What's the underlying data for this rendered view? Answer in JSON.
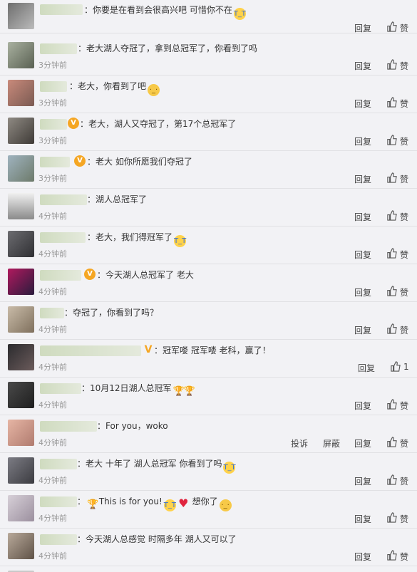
{
  "actions": {
    "reply": "回复",
    "like": "赞",
    "report": "投诉",
    "block": "屏蔽"
  },
  "comments": [
    {
      "text": "：你要是在看到会很高兴吧 可惜你不在",
      "time": "",
      "likes": ""
    },
    {
      "text": "：老大湖人夺冠了，拿到总冠军了，你看到了吗",
      "time": "3分钟前",
      "likes": ""
    },
    {
      "text": "：老大，你看到了吧",
      "time": "3分钟前",
      "likes": ""
    },
    {
      "text": "：老大，湖人又夺冠了，第17个总冠军了",
      "time": "3分钟前",
      "likes": ""
    },
    {
      "text": "：老大 如你所愿我们夺冠了",
      "time": "3分钟前",
      "likes": ""
    },
    {
      "text": "：湖人总冠军了",
      "time": "4分钟前",
      "likes": ""
    },
    {
      "text": "：老大，我们得冠军了",
      "time": "4分钟前",
      "likes": ""
    },
    {
      "text": "：今天湖人总冠军了 老大",
      "time": "4分钟前",
      "likes": ""
    },
    {
      "text": "：夺冠了，你看到了吗？",
      "time": "4分钟前",
      "likes": ""
    },
    {
      "text": "：冠军喽 冠军喽 老科，赢了！",
      "time": "4分钟前",
      "likes": "1"
    },
    {
      "text": "：10月12日湖人总冠军",
      "time": "4分钟前",
      "likes": ""
    },
    {
      "text": "：For you，woko",
      "time": "4分钟前",
      "likes": ""
    },
    {
      "text": "：老大 十年了 湖人总冠军 你看到了吗",
      "time": "4分钟前",
      "likes": ""
    },
    {
      "text": "：",
      "text2": "This is for you!",
      "text3": "想你了",
      "time": "4分钟前",
      "likes": ""
    },
    {
      "text": "：今天湖人总感觉 时隔多年 湖人又可以了",
      "time": "4分钟前",
      "likes": ""
    }
  ],
  "icons": {
    "thumb": "thumbs-up-icon",
    "emoji_cry": "crying-face-icon",
    "emoji_sad": "sad-face-icon",
    "heart": "heart-icon",
    "trophy": "trophy-icon",
    "vip": "vip-badge-icon"
  }
}
